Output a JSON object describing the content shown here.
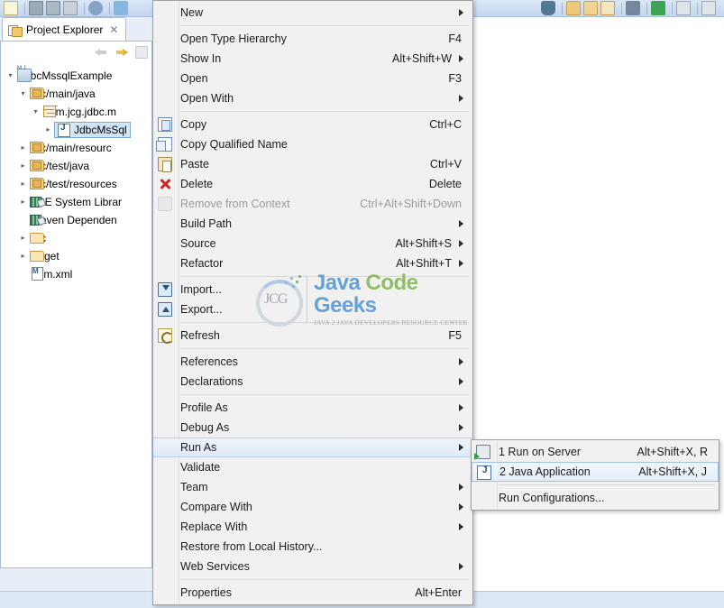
{
  "toolbar": {
    "icons_left": [
      "new-document-icon",
      "save-icon",
      "save-all-icon",
      "print-icon",
      "search-icon",
      "undo-icon"
    ],
    "icons_right": [
      "debug-icon",
      "open-folder-icon",
      "open-folder-alt-icon",
      "new-folder-icon",
      "shield-icon",
      "run-icon",
      "external-tools-icon",
      "misc-icon"
    ]
  },
  "view": {
    "tab_label": "Project Explorer",
    "tab_close": "✕",
    "nav": {
      "back": "back-arrow",
      "forward": "forward-arrow",
      "up": "collapse-all"
    },
    "tree": [
      {
        "label": "JdbcMssqlExample",
        "indent": 0,
        "twist": "▾",
        "icon": "project-icon",
        "selected": false
      },
      {
        "label": "src/main/java",
        "indent": 1,
        "twist": "▾",
        "icon": "source-folder-icon",
        "selected": false
      },
      {
        "label": "com.jcg.jdbc.m",
        "indent": 2,
        "twist": "▾",
        "icon": "package-icon",
        "selected": false
      },
      {
        "label": "JdbcMsSql",
        "indent": 3,
        "twist": "▸",
        "icon": "java-file-icon",
        "selected": true
      },
      {
        "label": "src/main/resourc",
        "indent": 1,
        "twist": "▸",
        "icon": "source-folder-icon",
        "selected": false
      },
      {
        "label": "src/test/java",
        "indent": 1,
        "twist": "▸",
        "icon": "source-folder-icon",
        "selected": false
      },
      {
        "label": "src/test/resources",
        "indent": 1,
        "twist": "▸",
        "icon": "source-folder-icon",
        "selected": false
      },
      {
        "label": "JRE System Librar",
        "indent": 1,
        "twist": "▸",
        "icon": "library-icon",
        "selected": false
      },
      {
        "label": "Maven Dependen",
        "indent": 1,
        "twist": "",
        "icon": "library-icon",
        "selected": false
      },
      {
        "label": "src",
        "indent": 1,
        "twist": "▸",
        "icon": "folder-icon",
        "selected": false
      },
      {
        "label": "target",
        "indent": 1,
        "twist": "▸",
        "icon": "folder-icon",
        "selected": false
      },
      {
        "label": "pom.xml",
        "indent": 1,
        "twist": "",
        "icon": "maven-file-icon",
        "selected": false
      }
    ]
  },
  "context_menu": {
    "items": [
      {
        "label": "New",
        "accel": "",
        "submenu": true,
        "icon": "",
        "disabled": false,
        "highlight": false,
        "sep_after": true
      },
      {
        "label": "Open Type Hierarchy",
        "accel": "F4",
        "submenu": false,
        "icon": "",
        "disabled": false,
        "highlight": false,
        "sep_after": false
      },
      {
        "label": "Show In",
        "accel": "Alt+Shift+W",
        "submenu": true,
        "icon": "",
        "disabled": false,
        "highlight": false,
        "sep_after": false
      },
      {
        "label": "Open",
        "accel": "F3",
        "submenu": false,
        "icon": "",
        "disabled": false,
        "highlight": false,
        "sep_after": false
      },
      {
        "label": "Open With",
        "accel": "",
        "submenu": true,
        "icon": "",
        "disabled": false,
        "highlight": false,
        "sep_after": true
      },
      {
        "label": "Copy",
        "accel": "Ctrl+C",
        "submenu": false,
        "icon": "copy-icon",
        "disabled": false,
        "highlight": false,
        "sep_after": false
      },
      {
        "label": "Copy Qualified Name",
        "accel": "",
        "submenu": false,
        "icon": "copy-qualified-name-icon",
        "disabled": false,
        "highlight": false,
        "sep_after": false
      },
      {
        "label": "Paste",
        "accel": "Ctrl+V",
        "submenu": false,
        "icon": "paste-icon",
        "disabled": false,
        "highlight": false,
        "sep_after": false
      },
      {
        "label": "Delete",
        "accel": "Delete",
        "submenu": false,
        "icon": "delete-icon",
        "disabled": false,
        "highlight": false,
        "sep_after": false
      },
      {
        "label": "Remove from Context",
        "accel": "Ctrl+Alt+Shift+Down",
        "submenu": false,
        "icon": "remove-from-context-icon",
        "disabled": true,
        "highlight": false,
        "sep_after": false
      },
      {
        "label": "Build Path",
        "accel": "",
        "submenu": true,
        "icon": "",
        "disabled": false,
        "highlight": false,
        "sep_after": false
      },
      {
        "label": "Source",
        "accel": "Alt+Shift+S",
        "submenu": true,
        "icon": "",
        "disabled": false,
        "highlight": false,
        "sep_after": false
      },
      {
        "label": "Refactor",
        "accel": "Alt+Shift+T",
        "submenu": true,
        "icon": "",
        "disabled": false,
        "highlight": false,
        "sep_after": true
      },
      {
        "label": "Import...",
        "accel": "",
        "submenu": false,
        "icon": "import-icon",
        "disabled": false,
        "highlight": false,
        "sep_after": false
      },
      {
        "label": "Export...",
        "accel": "",
        "submenu": false,
        "icon": "export-icon",
        "disabled": false,
        "highlight": false,
        "sep_after": true
      },
      {
        "label": "Refresh",
        "accel": "F5",
        "submenu": false,
        "icon": "refresh-icon",
        "disabled": false,
        "highlight": false,
        "sep_after": true
      },
      {
        "label": "References",
        "accel": "",
        "submenu": true,
        "icon": "",
        "disabled": false,
        "highlight": false,
        "sep_after": false
      },
      {
        "label": "Declarations",
        "accel": "",
        "submenu": true,
        "icon": "",
        "disabled": false,
        "highlight": false,
        "sep_after": true
      },
      {
        "label": "Profile As",
        "accel": "",
        "submenu": true,
        "icon": "",
        "disabled": false,
        "highlight": false,
        "sep_after": false
      },
      {
        "label": "Debug As",
        "accel": "",
        "submenu": true,
        "icon": "",
        "disabled": false,
        "highlight": false,
        "sep_after": false
      },
      {
        "label": "Run As",
        "accel": "",
        "submenu": true,
        "icon": "",
        "disabled": false,
        "highlight": true,
        "sep_after": false
      },
      {
        "label": "Validate",
        "accel": "",
        "submenu": false,
        "icon": "",
        "disabled": false,
        "highlight": false,
        "sep_after": false
      },
      {
        "label": "Team",
        "accel": "",
        "submenu": true,
        "icon": "",
        "disabled": false,
        "highlight": false,
        "sep_after": false
      },
      {
        "label": "Compare With",
        "accel": "",
        "submenu": true,
        "icon": "",
        "disabled": false,
        "highlight": false,
        "sep_after": false
      },
      {
        "label": "Replace With",
        "accel": "",
        "submenu": true,
        "icon": "",
        "disabled": false,
        "highlight": false,
        "sep_after": false
      },
      {
        "label": "Restore from Local History...",
        "accel": "",
        "submenu": false,
        "icon": "",
        "disabled": false,
        "highlight": false,
        "sep_after": false
      },
      {
        "label": "Web Services",
        "accel": "",
        "submenu": true,
        "icon": "",
        "disabled": false,
        "highlight": false,
        "sep_after": true
      },
      {
        "label": "Properties",
        "accel": "Alt+Enter",
        "submenu": false,
        "icon": "",
        "disabled": false,
        "highlight": false,
        "sep_after": false
      }
    ]
  },
  "run_as_submenu": {
    "items": [
      {
        "label": "1 Run on Server",
        "accel": "Alt+Shift+X, R",
        "icon": "run-on-server-icon",
        "selected": false,
        "sep_after": false
      },
      {
        "label": "2 Java Application",
        "accel": "Alt+Shift+X, J",
        "icon": "java-application-icon",
        "selected": true,
        "sep_after": true
      },
      {
        "label": "Run Configurations...",
        "accel": "",
        "icon": "",
        "selected": false,
        "sep_after": false
      }
    ]
  },
  "watermark": {
    "logo_text": "JCG",
    "title_word1": "Java",
    "title_word2": "Code",
    "title_word3": "Geeks",
    "subtitle": "JAVA 2 JAVA DEVELOPERS RESOURCE CENTER"
  },
  "colors": {
    "accent_blue": "#5b9bd5",
    "accent_green": "#8cb860",
    "menu_bg": "#f1f1f1",
    "highlight": "#dfeaf7",
    "selection": "#d6e7f8"
  }
}
